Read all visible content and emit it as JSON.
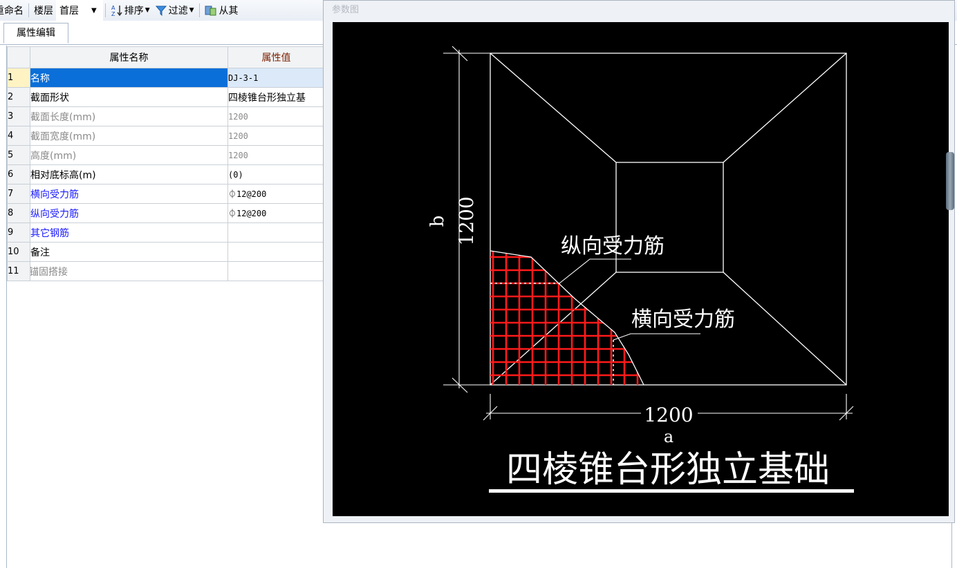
{
  "toolbar": {
    "rename_label": "重命名",
    "floor_label": "楼层",
    "floor_value": "首层",
    "sort_label": "排序",
    "filter_label": "过滤",
    "copy_label": "从其"
  },
  "tabs": [
    {
      "label": "属性编辑"
    }
  ],
  "table": {
    "headers": {
      "name": "属性名称",
      "value": "属性值"
    },
    "rows": [
      {
        "num": "1",
        "name": "名称",
        "value": "DJ-3-1"
      },
      {
        "num": "2",
        "name": "截面形状",
        "value": "四棱锥台形独立基"
      },
      {
        "num": "3",
        "name": "截面长度(mm)",
        "value": "1200"
      },
      {
        "num": "4",
        "name": "截面宽度(mm)",
        "value": "1200"
      },
      {
        "num": "5",
        "name": "高度(mm)",
        "value": "1200"
      },
      {
        "num": "6",
        "name": "相对底标高(m)",
        "value": "(0)"
      },
      {
        "num": "7",
        "name": "横向受力筋",
        "value": "⏀12@200"
      },
      {
        "num": "8",
        "name": "纵向受力筋",
        "value": "⏀12@200"
      },
      {
        "num": "9",
        "name": "其它钢筋",
        "value": ""
      },
      {
        "num": "10",
        "name": "备注",
        "value": ""
      },
      {
        "num": "11",
        "name": "锚固搭接",
        "value": ""
      }
    ]
  },
  "diagram": {
    "window_title": "参数图",
    "dim_b_value": "1200",
    "dim_b_label": "b",
    "dim_a_value": "1200",
    "dim_a_label": "a",
    "label_longitudinal": "纵向受力筋",
    "label_transverse": "横向受力筋",
    "caption": "四棱锥台形独立基础"
  }
}
